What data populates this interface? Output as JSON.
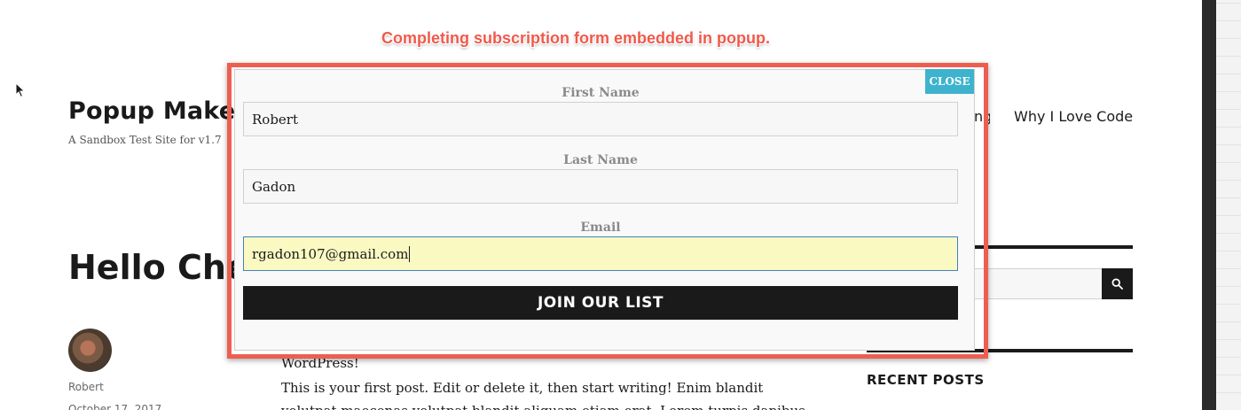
{
  "site": {
    "title": "Popup Make",
    "description": "A Sandbox Test Site for v1.7",
    "nav_fragment": "ng",
    "nav_item": "Why I Love Code"
  },
  "post": {
    "title": "Hello Che",
    "author": "Robert",
    "date": "October 17, 2017",
    "body_line1": "WordPress!",
    "body_line2": "This is your first post. Edit or delete it, then start writing! Enim blandit",
    "body_line3": "volutpat maecenas volutpat blandit aliquam etiam erat. Lorem turpis dapibus"
  },
  "sidebar": {
    "search_icon": "search-icon",
    "recent_posts_heading": "RECENT POSTS"
  },
  "annotation": {
    "text": "Completing subscription form embedded in popup.",
    "color": "#ef5a4b"
  },
  "popup": {
    "close_label": "CLOSE",
    "close_color": "#3db3cd",
    "outline_color": "#ee5e50",
    "fields": {
      "first_name_label": "First Name",
      "first_name_value": "Robert",
      "last_name_label": "Last Name",
      "last_name_value": "Gadon",
      "email_label": "Email",
      "email_value": "rgadon107@gmail.com"
    },
    "submit_label": "JOIN OUR LIST"
  }
}
